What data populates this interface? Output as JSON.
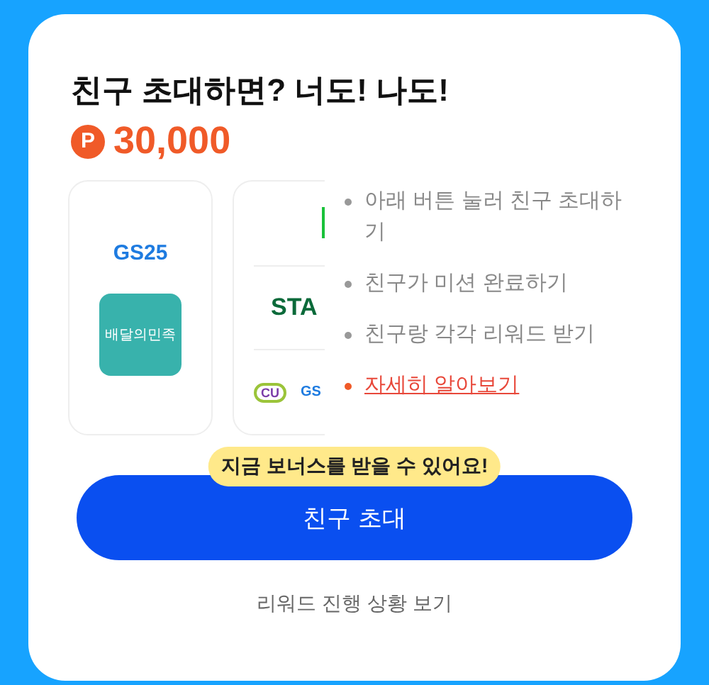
{
  "title": "친구 초대하면? 너도! 나도!",
  "reward": {
    "currency_symbol": "P",
    "amount": "30,000"
  },
  "partner_cards": [
    {
      "logos": [
        {
          "kind": "wordmark",
          "text": "GS25"
        },
        {
          "kind": "tile",
          "text": "배달의민족"
        }
      ]
    },
    {
      "logos": [
        {
          "kind": "bar"
        },
        {
          "kind": "wordmark-green",
          "text": "STA"
        },
        {
          "kind": "pair",
          "text": "CU",
          "text_2": "GS"
        }
      ]
    }
  ],
  "steps": [
    {
      "kind": "step",
      "text": "아래 버튼 눌러 친구 초대하기"
    },
    {
      "kind": "step",
      "text": "친구가 미션 완료하기"
    },
    {
      "kind": "step",
      "text": "친구랑 각각 리워드 받기"
    },
    {
      "kind": "link",
      "text": "자세히 알아보기"
    }
  ],
  "tooltip": "지금 보너스를 받을 수 있어요!",
  "primary_button": "친구 초대",
  "secondary_link": "리워드 진행 상황 보기"
}
